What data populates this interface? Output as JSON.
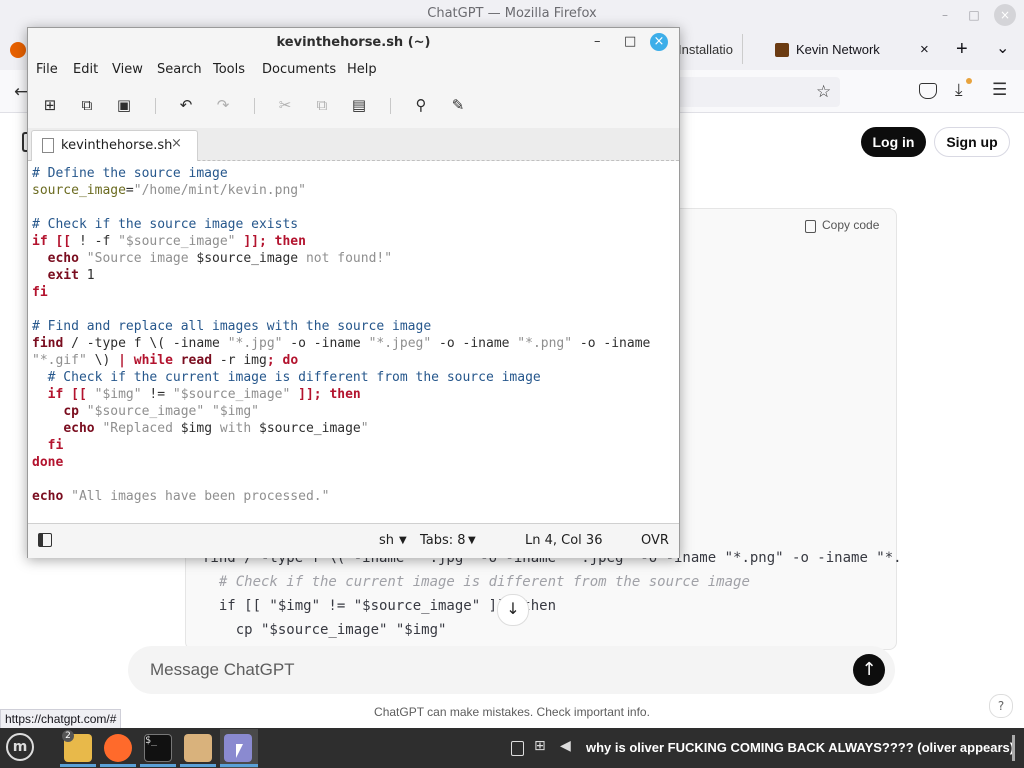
{
  "firefox": {
    "window_title": "ChatGPT — Mozilla Firefox",
    "tabs": [
      {
        "label": "Installatio",
        "close": "×"
      },
      {
        "label": "Kevin Network",
        "close": "×"
      }
    ],
    "new_tab": "+",
    "tab_list": "⌄",
    "status_url": "https://chatgpt.com/#"
  },
  "chatgpt": {
    "login_label": "Log in",
    "signup_label": "Sign up",
    "copy_code_label": "Copy code",
    "background_code": [
      "find / -type f \\( -iname \"*.jpg\" -o -iname \"*.jpeg\" -o -iname \"*.png\" -o -iname \"*.",
      "  # Check if the current image is different from the source image",
      "  if [[ \"$img\" != \"$source_image\" ]]; then",
      "    cp \"$source_image\" \"$img\""
    ],
    "message_placeholder": "Message ChatGPT",
    "disclaimer": "ChatGPT can make mistakes. Check important info.",
    "help_label": "?"
  },
  "gedit": {
    "title": "kevinthehorse.sh (~)",
    "menu": [
      "File",
      "Edit",
      "View",
      "Search",
      "Tools",
      "Documents",
      "Help"
    ],
    "tab_label": "kevinthehorse.sh",
    "tab_close": "×",
    "status": {
      "language": "sh",
      "tabs": "Tabs: 8",
      "position": "Ln 4, Col 36",
      "mode": "OVR"
    }
  },
  "taskbar": {
    "files_badge": "2",
    "notification_text": "why is oliver FUCKING COMING BACK ALWAYS???? (oliver appears)"
  },
  "colors": {
    "accent": "#3daee9",
    "taskbar_bg": "#2e2e2e",
    "chatgpt_black": "#0d0d0d"
  },
  "icons": [
    "firefox-icon",
    "search-icon",
    "new-file-icon",
    "save-icon",
    "undo-icon",
    "redo-icon",
    "cut-icon",
    "copy-icon",
    "paste-icon",
    "tools-icon",
    "sidebar-icon",
    "mint-menu-icon",
    "terminal-icon",
    "folder-icon",
    "text-editor-icon",
    "network-icon",
    "volume-icon"
  ]
}
